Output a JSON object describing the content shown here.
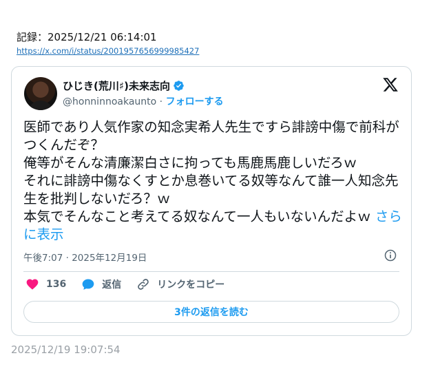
{
  "record": {
    "label": "記録：2025/12/21 06:14:01",
    "url": "https://x.com/i/status/2001957656999985427"
  },
  "tweet": {
    "display_name": "ひじき(荒川♯)未来志向",
    "handle": "@honninnoakaunto",
    "separator": " · ",
    "follow_label": "フォローする",
    "text": "医師であり人気作家の知念実希人先生ですら誹謗中傷で前科がつくんだぞ？\n俺等がそんな清廉潔白さに拘っても馬鹿馬鹿しいだろｗ\nそれに誹謗中傷なくすとか息巻いてる奴等なんて誰一人知念先生を批判しないだろ？ｗ\n本気でそんなこと考えてる奴なんて一人もいないんだよｗ",
    "show_more": "さらに表示",
    "timestamp": "午後7:07 · 2025年12月19日",
    "likes": "136",
    "reply_label": "返信",
    "copy_link_label": "リンクをコピー",
    "read_replies": "3件の返信を読む"
  },
  "colors": {
    "accent": "#1d9bf0",
    "like": "#f91880",
    "muted": "#536471",
    "border": "#cfd9de"
  },
  "footer": {
    "time": "2025/12/19 19:07:54"
  }
}
